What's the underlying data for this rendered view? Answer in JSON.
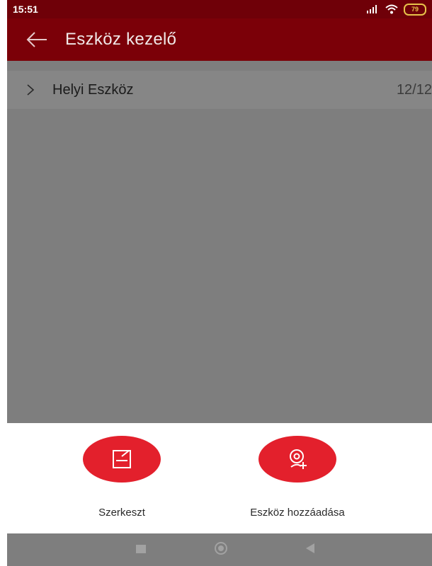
{
  "status_bar": {
    "time": "15:51",
    "battery": "79"
  },
  "app_bar": {
    "title": "Eszköz kezelő",
    "back_icon": "arrow-left-icon"
  },
  "device_list": {
    "groups": [
      {
        "name": "Helyi Eszköz",
        "count": "12/12",
        "icon": "chevron-right-icon"
      }
    ]
  },
  "actions": [
    {
      "label": "Szerkeszt",
      "icon": "edit-icon"
    },
    {
      "label": "Eszköz hozzáadása",
      "icon": "add-device-icon"
    }
  ],
  "colors": {
    "status_bar": "#6f0008",
    "app_bar": "#7b0008",
    "accent": "#e3202c",
    "overlay": "#7e7e7e"
  }
}
